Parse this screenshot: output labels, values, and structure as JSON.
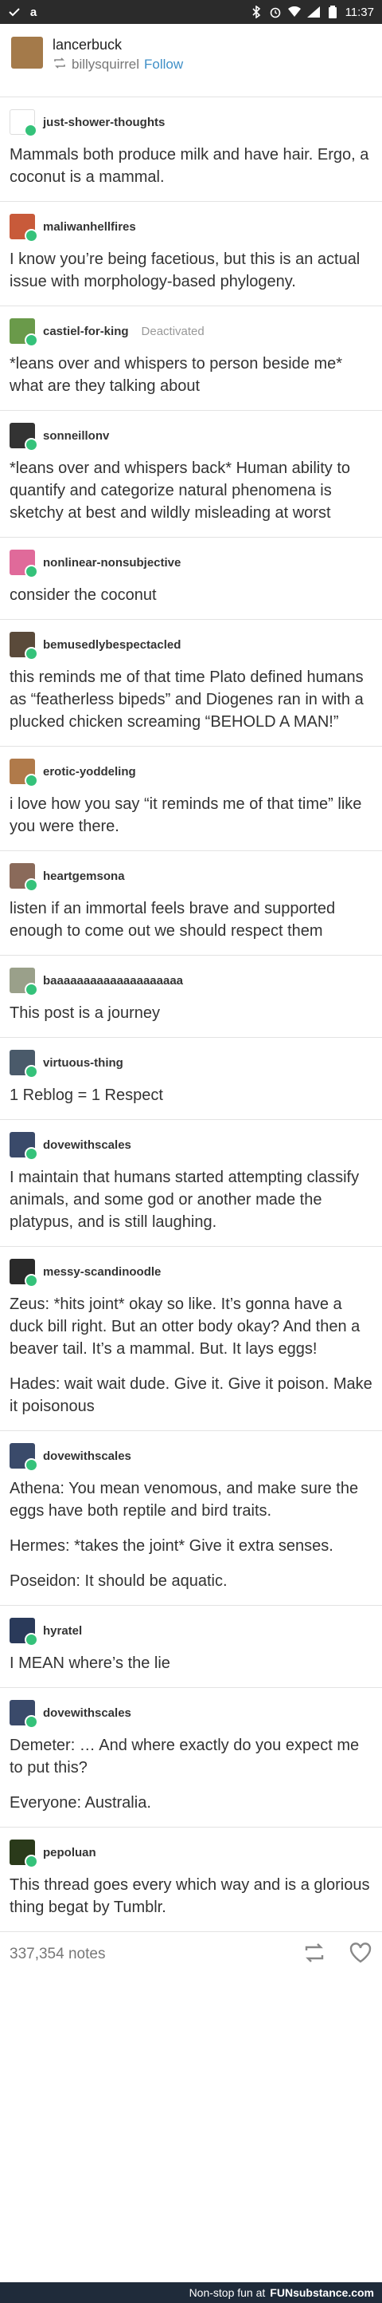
{
  "status_bar": {
    "time": "11:37"
  },
  "header": {
    "username": "lancerbuck",
    "reblogged_from": "billysquirrel",
    "follow_label": "Follow"
  },
  "posts": [
    {
      "user": "just-shower-thoughts",
      "paragraphs": [
        "Mammals both produce milk and have hair. Ergo, a coconut is a mammal."
      ],
      "avatar_color": "#ffffff"
    },
    {
      "user": "maliwanhellfires",
      "paragraphs": [
        "I know you’re being facetious, but this is an actual issue with morphology-based phylogeny."
      ],
      "avatar_color": "#c85a3a"
    },
    {
      "user": "castiel-for-king",
      "status": "Deactivated",
      "paragraphs": [
        "*leans over and whispers to person beside me* what are they talking about"
      ],
      "avatar_color": "#6a9a4a"
    },
    {
      "user": "sonneillonv",
      "paragraphs": [
        "*leans over and whispers back*  Human ability to quantify and categorize natural phenomena is sketchy at best and wildly misleading at worst"
      ],
      "avatar_color": "#333333"
    },
    {
      "user": "nonlinear-nonsubjective",
      "paragraphs": [
        "consider the coconut"
      ],
      "avatar_color": "#e06a9a"
    },
    {
      "user": "bemusedlybespectacled",
      "paragraphs": [
        "this reminds me of that time Plato defined humans as “featherless bipeds” and Diogenes ran in with a plucked chicken screaming “BEHOLD A MAN!”"
      ],
      "avatar_color": "#5a4a3a"
    },
    {
      "user": "erotic-yoddeling",
      "paragraphs": [
        "i love how you say “it reminds me of that time” like you were there."
      ],
      "avatar_color": "#b07a4a"
    },
    {
      "user": "heartgemsona",
      "paragraphs": [
        "listen if an immortal feels brave and supported enough to come out we should respect them"
      ],
      "avatar_color": "#8a6a5a"
    },
    {
      "user": "baaaaaaaaaaaaaaaaaaaa",
      "paragraphs": [
        "This post is a journey"
      ],
      "avatar_color": "#9aa08a"
    },
    {
      "user": "virtuous-thing",
      "paragraphs": [
        "1 Reblog = 1 Respect"
      ],
      "avatar_color": "#4a5a6a"
    },
    {
      "user": "dovewithscales",
      "paragraphs": [
        "I maintain that humans started attempting classify animals, and some god or another made the platypus, and is still laughing."
      ],
      "avatar_color": "#3a4a6a"
    },
    {
      "user": "messy-scandinoodle",
      "paragraphs": [
        "Zeus: *hits joint* okay so like. It’s gonna have a duck bill right. But an otter body okay? And then a beaver tail. It’s a mammal. But. It lays eggs!",
        "Hades: wait wait dude. Give it. Give it poison. Make it poisonous"
      ],
      "avatar_color": "#2a2a2a"
    },
    {
      "user": "dovewithscales",
      "paragraphs": [
        "Athena: You mean venomous, and make sure the eggs have both reptile and bird traits.",
        "Hermes: *takes the joint* Give it extra senses.",
        "Poseidon: It should be aquatic."
      ],
      "avatar_color": "#3a4a6a"
    },
    {
      "user": "hyratel",
      "paragraphs": [
        "I MEAN where’s the lie"
      ],
      "avatar_color": "#2a3a5a"
    },
    {
      "user": "dovewithscales",
      "paragraphs": [
        "Demeter: … And where exactly do you expect me to put this?",
        "Everyone: Australia."
      ],
      "avatar_color": "#3a4a6a"
    },
    {
      "user": "pepoluan",
      "paragraphs": [
        "This thread goes every which way and is a glorious thing begat by Tumblr."
      ],
      "avatar_color": "#2a3a1a"
    }
  ],
  "footer": {
    "notes": "337,354 notes"
  },
  "watermark": {
    "text": "Non-stop fun at",
    "brand": "FUNsubstance.com"
  },
  "colors": {
    "badge": "#35c27a",
    "follow": "#3f8fc7"
  }
}
